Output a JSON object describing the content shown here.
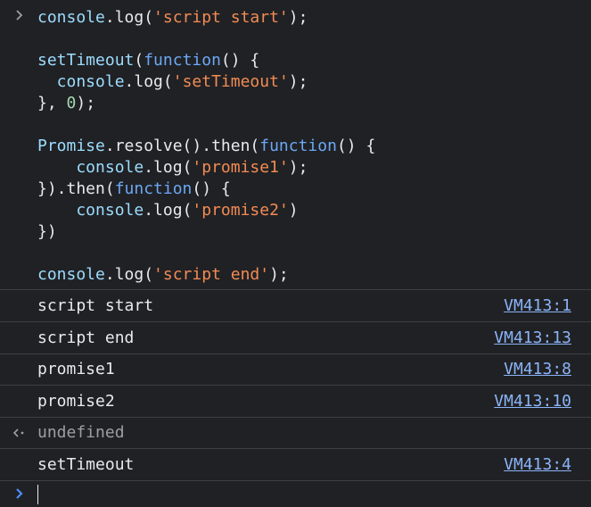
{
  "input": {
    "lines": [
      [
        {
          "t": "console",
          "c": "fn"
        },
        {
          "t": ".log(",
          "c": "punc"
        },
        {
          "t": "'script start'",
          "c": "str"
        },
        {
          "t": ");",
          "c": "punc"
        }
      ],
      [],
      [
        {
          "t": "setTimeout",
          "c": "fn"
        },
        {
          "t": "(",
          "c": "punc"
        },
        {
          "t": "function",
          "c": "kw"
        },
        {
          "t": "() {",
          "c": "punc"
        }
      ],
      [
        {
          "t": "  console",
          "c": "fn"
        },
        {
          "t": ".log(",
          "c": "punc"
        },
        {
          "t": "'setTimeout'",
          "c": "str"
        },
        {
          "t": ");",
          "c": "punc"
        }
      ],
      [
        {
          "t": "}, ",
          "c": "punc"
        },
        {
          "t": "0",
          "c": "num"
        },
        {
          "t": ");",
          "c": "punc"
        }
      ],
      [],
      [
        {
          "t": "Promise",
          "c": "fn"
        },
        {
          "t": ".resolve().then(",
          "c": "punc"
        },
        {
          "t": "function",
          "c": "kw"
        },
        {
          "t": "() {",
          "c": "punc"
        }
      ],
      [
        {
          "t": "    console",
          "c": "fn"
        },
        {
          "t": ".log(",
          "c": "punc"
        },
        {
          "t": "'promise1'",
          "c": "str"
        },
        {
          "t": ");",
          "c": "punc"
        }
      ],
      [
        {
          "t": "}).then(",
          "c": "punc"
        },
        {
          "t": "function",
          "c": "kw"
        },
        {
          "t": "() {",
          "c": "punc"
        }
      ],
      [
        {
          "t": "    console",
          "c": "fn"
        },
        {
          "t": ".log(",
          "c": "punc"
        },
        {
          "t": "'promise2'",
          "c": "str"
        },
        {
          "t": ")",
          "c": "punc"
        }
      ],
      [
        {
          "t": "})",
          "c": "punc"
        }
      ],
      [],
      [
        {
          "t": "console",
          "c": "fn"
        },
        {
          "t": ".log(",
          "c": "punc"
        },
        {
          "t": "'script end'",
          "c": "str"
        },
        {
          "t": ");",
          "c": "punc"
        }
      ]
    ]
  },
  "logs": [
    {
      "text": "script start",
      "source": "VM413:1",
      "kind": "log"
    },
    {
      "text": "script end",
      "source": "VM413:13",
      "kind": "log"
    },
    {
      "text": "promise1",
      "source": "VM413:8",
      "kind": "log"
    },
    {
      "text": "promise2",
      "source": "VM413:10",
      "kind": "log"
    },
    {
      "text": "undefined",
      "source": "",
      "kind": "return"
    },
    {
      "text": "setTimeout",
      "source": "VM413:4",
      "kind": "log"
    }
  ],
  "icons": {
    "prompt": "chevron-right-icon",
    "return": "return-value-icon"
  },
  "colors": {
    "background": "#202124",
    "text": "#e8eaed",
    "link": "#8ab4f8",
    "string": "#f28b54",
    "keyword": "#6ba8f5",
    "identifier": "#9cdcfe",
    "number": "#a3d9b1",
    "muted": "#9aa0a6",
    "divider": "#3c4043"
  }
}
